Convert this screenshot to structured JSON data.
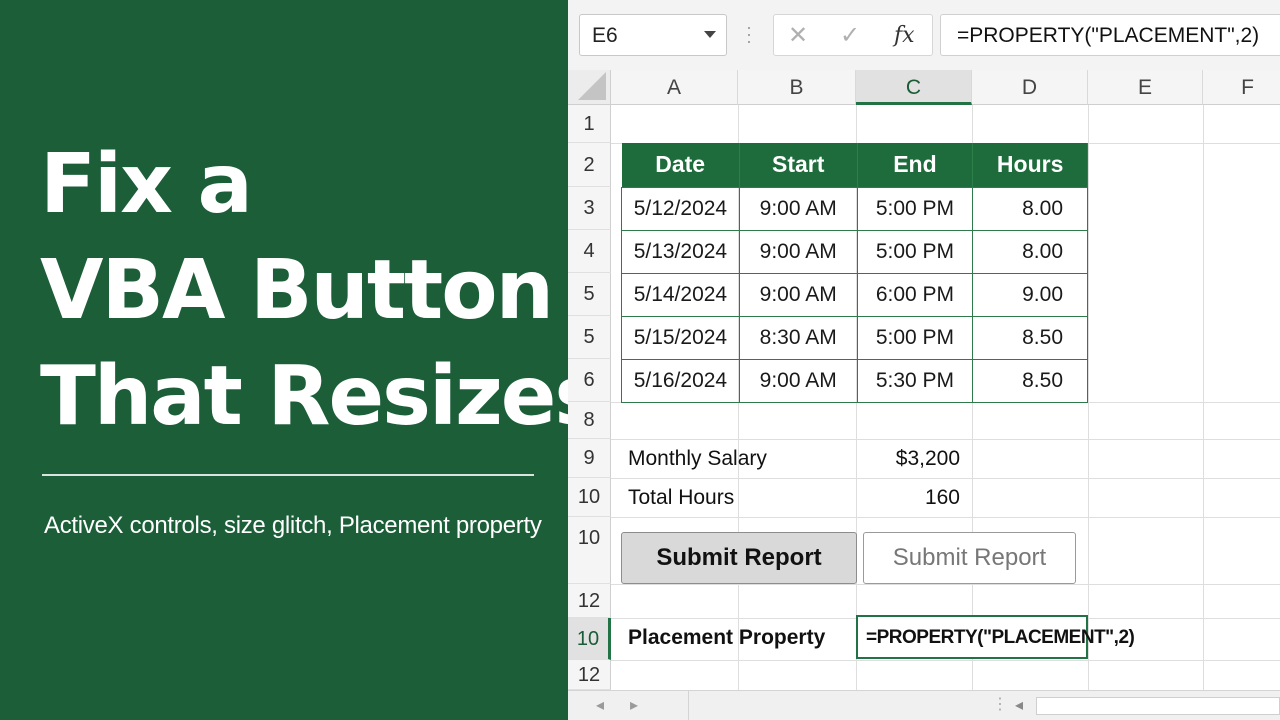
{
  "headline": {
    "line1": "Fix a",
    "line2": "VBA Button",
    "line3": "That Resizes",
    "subtitle": "ActiveX controls, size glitch, Placement property"
  },
  "formula_bar": {
    "name_box": "E6",
    "cancel_icon": "✕",
    "enter_icon": "✓",
    "fx_icon": "fx",
    "formula": "=PROPERTY(\"PLACEMENT\",2)"
  },
  "columns": [
    "A",
    "B",
    "C",
    "D",
    "E",
    "F"
  ],
  "rows": [
    "1",
    "2",
    "3",
    "4",
    "5",
    "5",
    "6",
    "8",
    "9",
    "10",
    "10",
    "12",
    "10",
    "12"
  ],
  "table": {
    "headers": [
      "Date",
      "Start",
      "End",
      "Hours"
    ],
    "rows": [
      [
        "5/12/2024",
        "9:00 AM",
        "5:00 PM",
        "8.00"
      ],
      [
        "5/13/2024",
        "9:00 AM",
        "5:00 PM",
        "8.00"
      ],
      [
        "5/14/2024",
        "9:00 AM",
        "6:00 PM",
        "9.00"
      ],
      [
        "5/15/2024",
        "8:30 AM",
        "5:00 PM",
        "8.50"
      ],
      [
        "5/16/2024",
        "9:00 AM",
        "5:30 PM",
        "8.50"
      ]
    ]
  },
  "summary": {
    "salary_label": "Monthly Salary",
    "salary_value": "$3,200",
    "hours_label": "Total Hours",
    "hours_value": "160"
  },
  "buttons": {
    "pressed_label": "Submit Report",
    "normal_label": "Submit Report"
  },
  "placement": {
    "label": "Placement Property",
    "formula": "=PROPERTY(\"PLACEMENT\",2)"
  },
  "status_bar": {
    "prev_icon": "◂",
    "next_icon": "▸",
    "grip_icon": "⋮",
    "scroll_left_icon": "◂"
  },
  "colors": {
    "brand_green": "#1b5e38",
    "table_header": "#1e6b3c",
    "selection": "#217346"
  }
}
